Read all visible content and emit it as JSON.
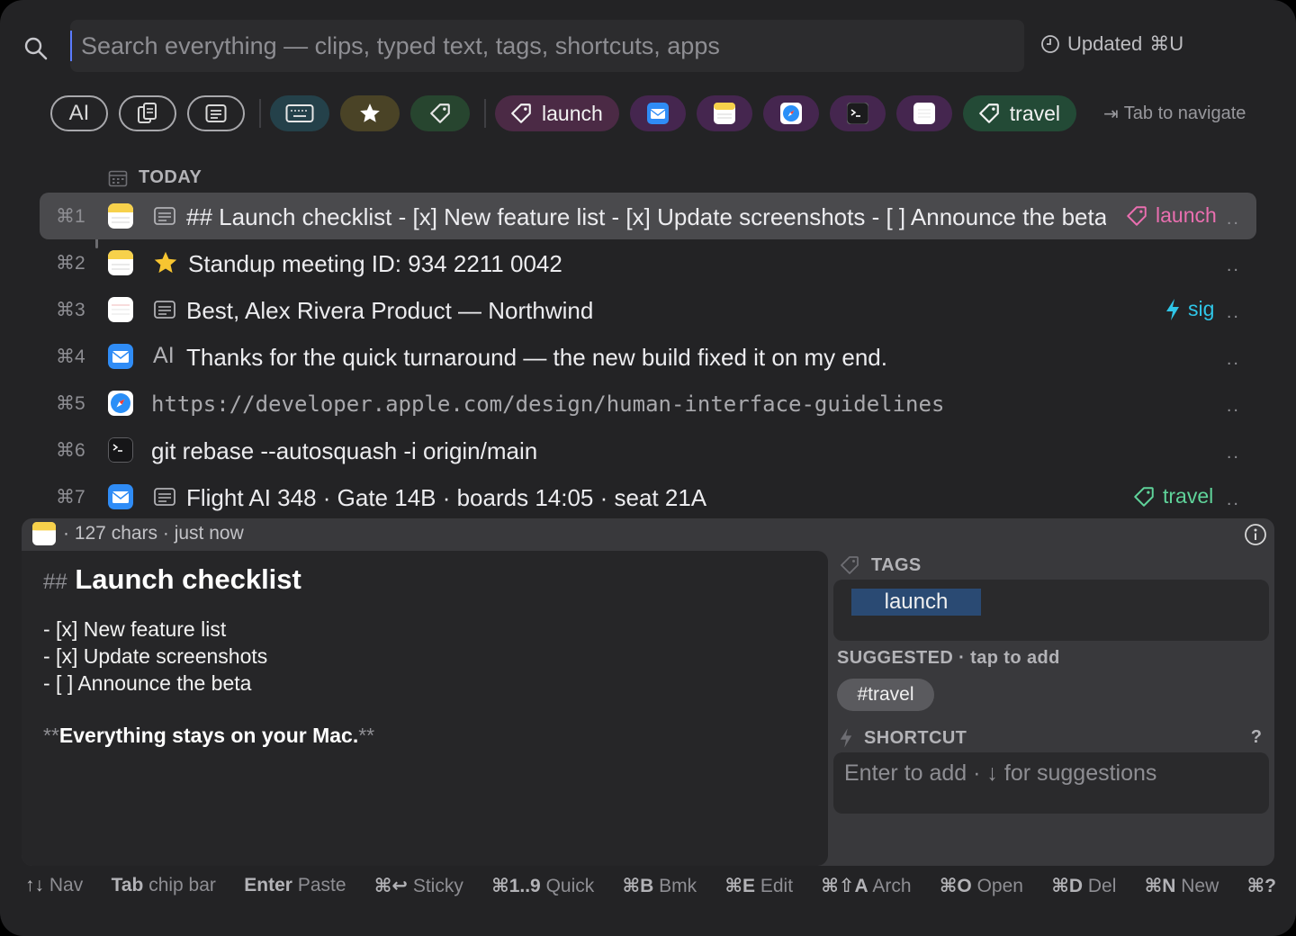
{
  "search": {
    "placeholder": "Search everything — clips, typed text, tags, shortcuts, apps",
    "value": ""
  },
  "status": {
    "updated_label": "Updated",
    "updated_shortcut": "⌘U"
  },
  "chips": {
    "filters": [
      {
        "icon": "typed-text-icon",
        "label": ""
      },
      {
        "icon": "clipboard-icon",
        "label": ""
      },
      {
        "icon": "note-icon",
        "label": ""
      }
    ],
    "kinds": [
      {
        "icon": "keyboard-icon",
        "color": "#24414a"
      },
      {
        "icon": "star-icon",
        "color": "#4a4326"
      },
      {
        "icon": "tag-icon",
        "color": "#27452f"
      }
    ],
    "launch_label": "launch",
    "travel_label": "travel",
    "apps": [
      "mail-app-icon",
      "notes-app-icon",
      "safari-app-icon",
      "terminal-app-icon",
      "reminders-app-icon"
    ],
    "nav_hint": "Tab to navigate"
  },
  "section": {
    "title": "TODAY"
  },
  "rows": [
    {
      "key": "⌘1",
      "app": "notes",
      "kind": "note",
      "text": "## Launch checklist  - [x] New feature list - [x] Update screenshots - [ ] Announce the beta",
      "tag": "launch",
      "tag_color": "#ea6fb0",
      "selected": true
    },
    {
      "key": "⌘2",
      "app": "notes",
      "kind": "star",
      "text": "Standup meeting ID: 934 2211 0042",
      "tag": "",
      "selected": false
    },
    {
      "key": "⌘3",
      "app": "reminders",
      "kind": "note",
      "text": "Best, Alex Rivera Product — Northwind",
      "tag": "sig",
      "tag_color": "#2fc6e8",
      "selected": false
    },
    {
      "key": "⌘4",
      "app": "mail",
      "kind": "typed",
      "text": "Thanks for the quick turnaround — the new build fixed it on my end.",
      "tag": "",
      "selected": false
    },
    {
      "key": "⌘5",
      "app": "safari",
      "kind": "",
      "text": "https://developer.apple.com/design/human-interface-guidelines",
      "tag": "",
      "selected": false
    },
    {
      "key": "⌘6",
      "app": "terminal",
      "kind": "",
      "text": "git rebase --autosquash -i origin/main",
      "tag": "",
      "selected": false
    },
    {
      "key": "⌘7",
      "app": "mail",
      "kind": "note",
      "text": "Flight AI 348 · Gate 14B · boards 14:05 · seat 21A",
      "tag": "travel",
      "tag_color": "#5fd39a",
      "selected": false
    }
  ],
  "more_label": "..",
  "detail": {
    "meta": "· 127 chars · just now",
    "heading_marker": "##",
    "heading": "Launch checklist",
    "lines": [
      "- [x] New feature list",
      "- [x] Update screenshots",
      "- [ ] Announce the beta"
    ],
    "bold_marker_open": "**",
    "bold_text": "Everything stays on your Mac.",
    "bold_marker_close": "**",
    "tags_label": "TAGS",
    "tag": "launch",
    "suggested_label": "SUGGESTED · tap to add",
    "suggested_tag": "#travel",
    "shortcut_label": "SHORTCUT",
    "shortcut_help": "?",
    "shortcut_placeholder": "Enter to add · ↓ for suggestions"
  },
  "footer": [
    {
      "keys": "↑↓",
      "label": "Nav"
    },
    {
      "keys": "Tab",
      "label": "chip bar"
    },
    {
      "keys": "Enter",
      "label": "Paste"
    },
    {
      "keys": "⌘↩",
      "label": "Sticky"
    },
    {
      "keys": "⌘1..9",
      "label": "Quick"
    },
    {
      "keys": "⌘B",
      "label": "Bmk"
    },
    {
      "keys": "⌘E",
      "label": "Edit"
    },
    {
      "keys": "⌘⇧A",
      "label": "Arch"
    },
    {
      "keys": "⌘O",
      "label": "Open"
    },
    {
      "keys": "⌘D",
      "label": "Del"
    },
    {
      "keys": "⌘N",
      "label": "New"
    },
    {
      "keys": "⌘?",
      "label": ""
    }
  ]
}
